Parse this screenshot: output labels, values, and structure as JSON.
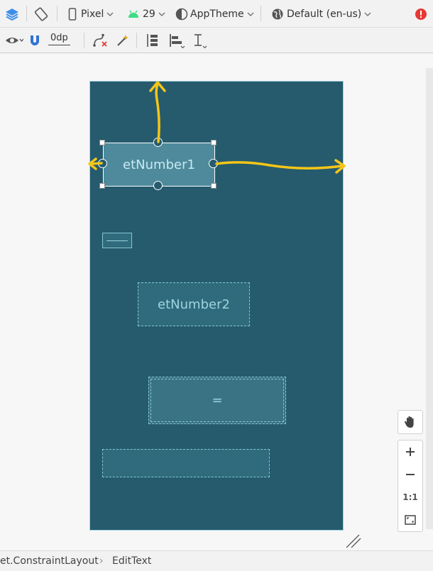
{
  "toolbar": {
    "device": "Pixel",
    "api_level": "29",
    "theme": "AppTheme",
    "locale": "Default (en-us)",
    "margin_value": "0dp"
  },
  "layout": {
    "widgets": {
      "et_number1": "etNumber1",
      "et_number2": "etNumber2",
      "equals_button": "="
    }
  },
  "zoom": {
    "reset": "1:1"
  },
  "breadcrumb": {
    "parent": "et.ConstraintLayout",
    "separator": "›",
    "current": "EditText"
  },
  "colors": {
    "canvas": "#255b6d",
    "annotation_arrow": "#f5c518",
    "error": "#e53935"
  }
}
